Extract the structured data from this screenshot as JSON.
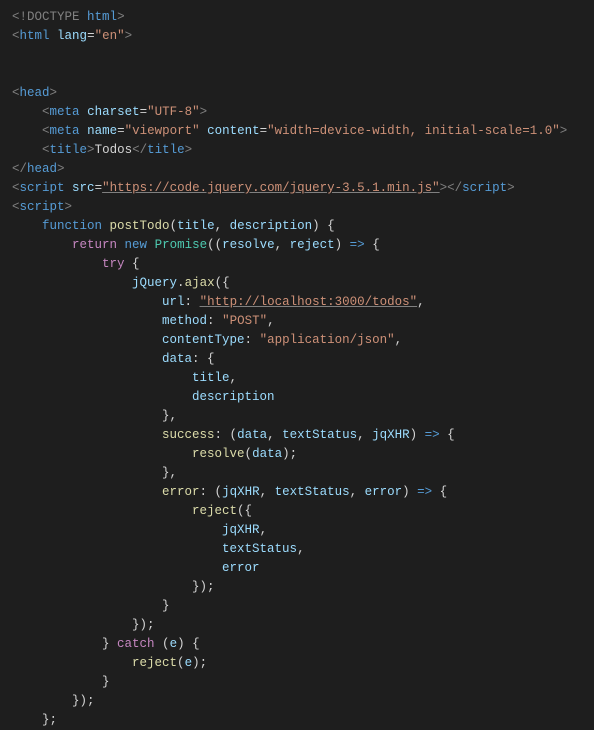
{
  "code": {
    "doctype": "!DOCTYPE",
    "doctype_val": "html",
    "html_tag": "html",
    "lang_attr": "lang",
    "lang_val": "\"en\"",
    "head_tag": "head",
    "meta_tag": "meta",
    "charset_attr": "charset",
    "charset_val": "\"UTF-8\"",
    "name_attr": "name",
    "viewport_val": "\"viewport\"",
    "content_attr": "content",
    "content_val": "\"width=device-width, initial-scale=1.0\"",
    "title_tag": "title",
    "title_text": "Todos",
    "script_tag": "script",
    "src_attr": "src",
    "jquery_url": "\"https://code.jquery.com/jquery-3.5.1.min.js\"",
    "kw_function": "function",
    "fn_postTodo": "postTodo",
    "param_title": "title",
    "param_description": "description",
    "kw_return": "return",
    "kw_new": "new",
    "cls_Promise": "Promise",
    "param_resolve": "resolve",
    "param_reject": "reject",
    "arrow": "=>",
    "kw_try": "try",
    "var_jQuery": "jQuery",
    "fn_ajax": "ajax",
    "prop_url": "url",
    "url_val": "\"http://localhost:3000/todos\"",
    "prop_method": "method",
    "method_val": "\"POST\"",
    "prop_contentType": "contentType",
    "contentType_val": "\"application/json\"",
    "prop_data": "data",
    "shorthand_title": "title",
    "shorthand_description": "description",
    "prop_success": "success",
    "param_data": "data",
    "param_textStatus": "textStatus",
    "param_jqXHR": "jqXHR",
    "fn_resolve": "resolve",
    "prop_error": "error",
    "param_error": "error",
    "fn_reject": "reject",
    "shorthand_jqXHR": "jqXHR",
    "shorthand_textStatus": "textStatus",
    "shorthand_error": "error",
    "kw_catch": "catch",
    "param_e": "e"
  }
}
